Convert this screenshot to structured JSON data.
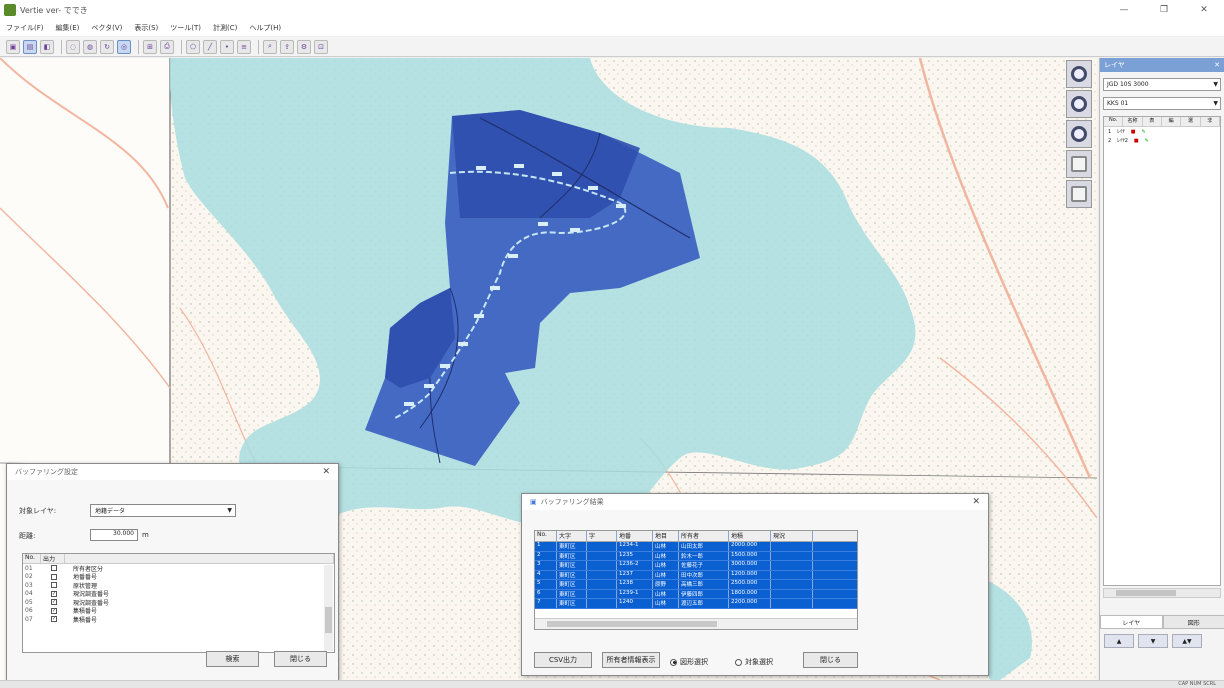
{
  "window": {
    "title": "Vertie ver- ででき",
    "controls": [
      "—",
      "❐",
      "✕"
    ]
  },
  "menu": [
    "ファイル(F)",
    "編集(E)",
    "ベクタ(V)",
    "表示(S)",
    "ツール(T)",
    "計測(C)",
    "ヘルプ(H)"
  ],
  "layer_panel": {
    "title": "レイヤ",
    "close": "✕",
    "select1": "JGD 10S 3000",
    "select2": "KKS 01",
    "columns": [
      "No.",
      "名称",
      "表",
      "編",
      "選",
      "非"
    ],
    "rows": [
      [
        "1",
        "ﾚｲﾔ",
        "",
        "",
        "",
        ""
      ],
      [
        "2",
        "ﾚｲﾔ2",
        "",
        "",
        "",
        ""
      ]
    ],
    "tabs": [
      "レイヤ",
      "図形"
    ],
    "buttons": [
      "▲",
      "▼",
      "▲▼"
    ]
  },
  "settings_dialog": {
    "title": "バッファリング設定",
    "close": "✕",
    "layer_label": "対象レイヤ:",
    "layer_value": "地籍データ",
    "distance_label": "距離:",
    "distance_value": "30.000",
    "distance_unit": "m",
    "columns": [
      "No.",
      "出力",
      ""
    ],
    "rows": [
      {
        "no": "01",
        "checked": false,
        "label": "所有者区分"
      },
      {
        "no": "02",
        "checked": false,
        "label": "地番番号"
      },
      {
        "no": "03",
        "checked": false,
        "label": "原状管理"
      },
      {
        "no": "04",
        "checked": true,
        "label": "現況調査番号"
      },
      {
        "no": "05",
        "checked": true,
        "label": "現況調査番号"
      },
      {
        "no": "06",
        "checked": true,
        "label": "集積番号"
      },
      {
        "no": "07",
        "checked": true,
        "label": "集積番号"
      }
    ],
    "search_button": "検索",
    "close_button": "閉じる"
  },
  "result_dialog": {
    "title": "バッファリング結果",
    "close": "✕",
    "columns": [
      "No.",
      "大字",
      "字",
      "地番",
      "地目",
      "所有者",
      "地積",
      "現況"
    ],
    "rows": [
      [
        "1",
        "東町区",
        "",
        "1234-1",
        "山林",
        "山田太郎",
        "2000.000",
        ""
      ],
      [
        "2",
        "東町区",
        "",
        "1235",
        "山林",
        "鈴木一郎",
        "1500.000",
        ""
      ],
      [
        "3",
        "東町区",
        "",
        "1236-2",
        "山林",
        "佐藤花子",
        "3000.000",
        ""
      ],
      [
        "4",
        "東町区",
        "",
        "1237",
        "山林",
        "田中次郎",
        "1200.000",
        ""
      ],
      [
        "5",
        "東町区",
        "",
        "1238",
        "原野",
        "高橋三郎",
        "2500.000",
        ""
      ],
      [
        "6",
        "東町区",
        "",
        "1239-1",
        "山林",
        "伊藤四郎",
        "1800.000",
        ""
      ],
      [
        "7",
        "東町区",
        "",
        "1240",
        "山林",
        "渡辺五郎",
        "2200.000",
        ""
      ]
    ],
    "csv_button": "CSV出力",
    "attr_button": "所有者情報表示",
    "radio1": "図形選択",
    "radio2": "対象選択",
    "close_button": "閉じる"
  },
  "status": {
    "left": "",
    "coord": "CAP NUM SCRL"
  },
  "colors": {
    "buffer_fill": "#a8dde0",
    "parcel_fill": "#3b5fc0",
    "selection": "#0a5fd1",
    "map_base": "#fbf6ef",
    "road": "#f3b9a6"
  }
}
